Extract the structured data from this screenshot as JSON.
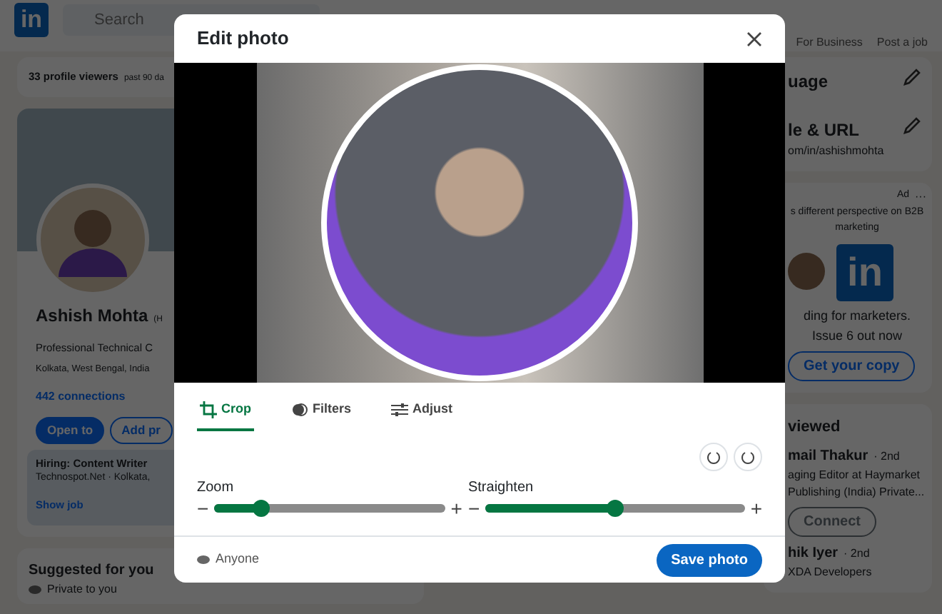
{
  "nav": {
    "logo": "in",
    "search_placeholder": "Search",
    "items": [
      "For Business",
      "Post a job"
    ]
  },
  "left": {
    "viewers": {
      "count": "33 profile viewers",
      "period": "past 90 da"
    },
    "profile": {
      "name": "Ashish Mohta",
      "name_suffix": "(H",
      "headline": "Professional Technical C",
      "location": "Kolkata, West Bengal, India",
      "connections": "442 connections",
      "buttons": [
        "Open to",
        "Add pr"
      ],
      "job": {
        "title": "Hiring: Content Writer",
        "company": "Technospot.Net · Kolkata,",
        "link": "Show job"
      }
    },
    "suggested": {
      "title": "Suggested for you",
      "note": "Private to you"
    }
  },
  "right": {
    "language": "uage",
    "url_title": "le & URL",
    "url": "om/in/ashishmohta",
    "ad": {
      "label": "Ad",
      "more": "···",
      "tagline": "s different perspective on B2B marketing",
      "logo": "in",
      "text": "ding for marketers. Issue 6 out now",
      "button": "Get your copy"
    },
    "viewed": {
      "title": "viewed",
      "people": [
        {
          "name": "mail Thakur",
          "degree": "· 2nd",
          "headline": "aging Editor at Haymarket Publishing (India) Private...",
          "button": "Connect"
        },
        {
          "name": "hik Iyer",
          "degree": "· 2nd",
          "headline": "XDA Developers"
        }
      ]
    }
  },
  "dialog": {
    "title": "Edit photo",
    "tabs": [
      {
        "label": "Crop",
        "selected": true,
        "kind": "crop"
      },
      {
        "label": "Filters",
        "selected": false,
        "kind": "filters"
      },
      {
        "label": "Adjust",
        "selected": false,
        "kind": "adjust"
      }
    ],
    "sliders": [
      {
        "label": "Zoom",
        "minus": "−",
        "plus": "+",
        "level": 0.2
      },
      {
        "label": "Straighten",
        "minus": "−",
        "plus": "+",
        "level": 0.5
      }
    ],
    "visibility": "Anyone",
    "save": "Save photo"
  }
}
